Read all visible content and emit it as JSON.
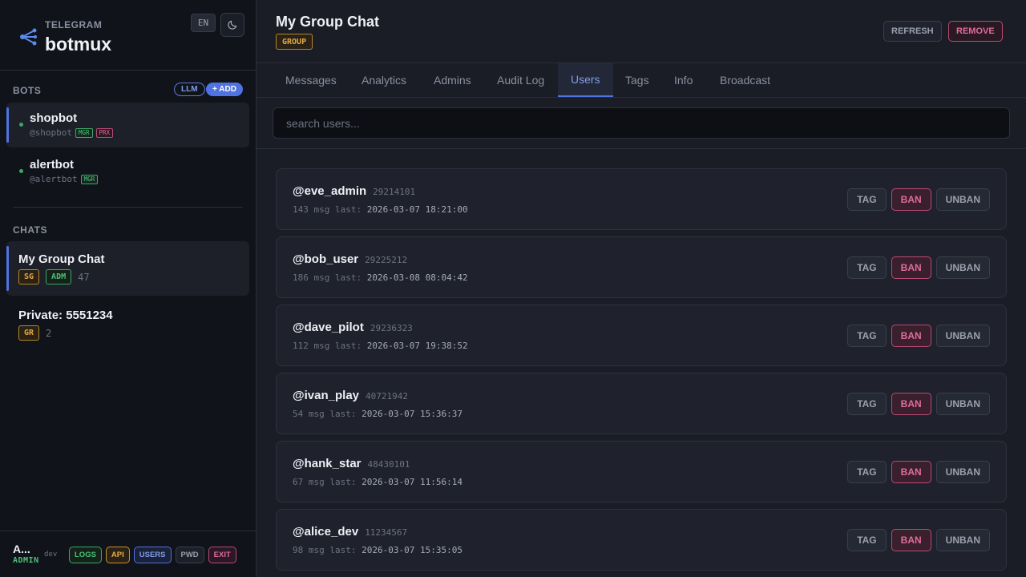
{
  "brand": {
    "subtitle": "TELEGRAM",
    "title": "botmux",
    "lang": "EN",
    "icon": "share-nodes-icon"
  },
  "sidebar": {
    "bots_label": "BOTS",
    "llm_label": "LLM",
    "add_label": "+ ADD",
    "bots": [
      {
        "name": "shopbot",
        "handle": "@shopbot",
        "tags": [
          "MGR",
          "PRX"
        ]
      },
      {
        "name": "alertbot",
        "handle": "@alertbot",
        "tags": [
          "MGR"
        ]
      }
    ],
    "chats_label": "CHATS",
    "chats": [
      {
        "name": "My Group Chat",
        "tags": [
          "SG",
          "ADM"
        ],
        "count": "47"
      },
      {
        "name": "Private: 5551234",
        "tags": [
          "GR"
        ],
        "count": "2"
      }
    ]
  },
  "footer": {
    "user": "A...",
    "role": "ADMIN",
    "env": "dev",
    "buttons": {
      "logs": "LOGS",
      "api": "API",
      "users": "USERS",
      "pwd": "PWD",
      "exit": "EXIT"
    }
  },
  "header": {
    "title": "My Group Chat",
    "badge": "GROUP",
    "refresh": "REFRESH",
    "remove": "REMOVE"
  },
  "tabs": [
    "Messages",
    "Analytics",
    "Admins",
    "Audit Log",
    "Users",
    "Tags",
    "Info",
    "Broadcast"
  ],
  "active_tab": "Users",
  "search": {
    "placeholder": "search users...",
    "value": ""
  },
  "users": [
    {
      "name": "@eve_admin",
      "id": "29214101",
      "msgs": "143",
      "msg_label": "msg",
      "last_label": "last:",
      "last": "2026-03-07 18:21:00"
    },
    {
      "name": "@bob_user",
      "id": "29225212",
      "msgs": "186",
      "msg_label": "msg",
      "last_label": "last:",
      "last": "2026-03-08 08:04:42"
    },
    {
      "name": "@dave_pilot",
      "id": "29236323",
      "msgs": "112",
      "msg_label": "msg",
      "last_label": "last:",
      "last": "2026-03-07 19:38:52"
    },
    {
      "name": "@ivan_play",
      "id": "40721942",
      "msgs": "54",
      "msg_label": "msg",
      "last_label": "last:",
      "last": "2026-03-07 15:36:37"
    },
    {
      "name": "@hank_star",
      "id": "48430101",
      "msgs": "67",
      "msg_label": "msg",
      "last_label": "last:",
      "last": "2026-03-07 11:56:14"
    },
    {
      "name": "@alice_dev",
      "id": "11234567",
      "msgs": "98",
      "msg_label": "msg",
      "last_label": "last:",
      "last": "2026-03-07 15:35:05"
    }
  ],
  "user_actions": {
    "tag": "TAG",
    "ban": "BAN",
    "unban": "UNBAN"
  },
  "colors": {
    "accent": "#4f73e0",
    "success": "#4cc27a",
    "danger": "#e06c9e",
    "warning": "#e0a84a"
  }
}
